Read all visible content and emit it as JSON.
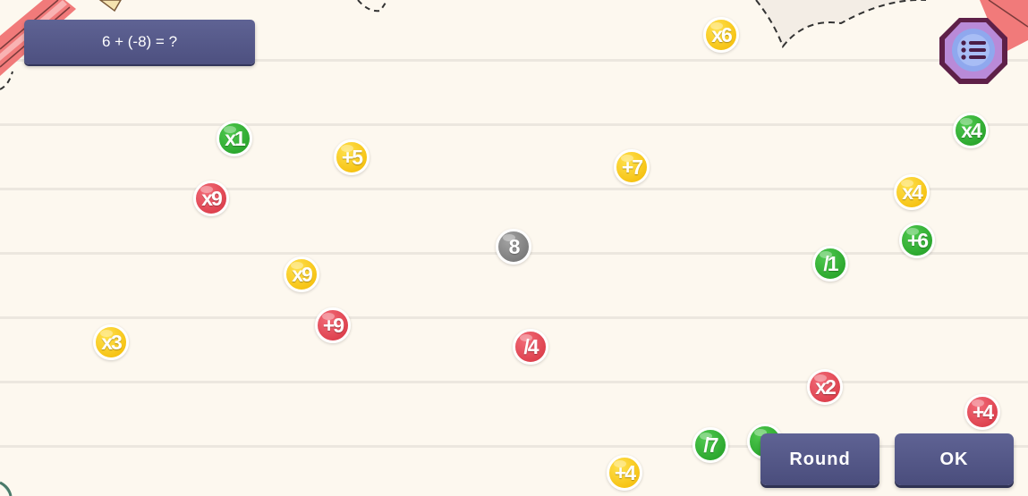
{
  "question": {
    "text": "6 + (-8) = ?"
  },
  "buttons": {
    "round": "Round",
    "ok": "OK"
  },
  "menu": {
    "icon": "list-icon"
  },
  "balls": [
    {
      "label": "x6",
      "color": "yellow"
    },
    {
      "label": "x1",
      "color": "green"
    },
    {
      "label": "+5",
      "color": "yellow"
    },
    {
      "label": "+7",
      "color": "yellow"
    },
    {
      "label": "x4",
      "color": "green"
    },
    {
      "label": "x9",
      "color": "red"
    },
    {
      "label": "x4",
      "color": "yellow"
    },
    {
      "label": "8",
      "color": "gray"
    },
    {
      "label": "+6",
      "color": "green"
    },
    {
      "label": "x9",
      "color": "yellow"
    },
    {
      "label": "/1",
      "color": "green"
    },
    {
      "label": "+9",
      "color": "red"
    },
    {
      "label": "x3",
      "color": "yellow"
    },
    {
      "label": "/4",
      "color": "red"
    },
    {
      "label": "x2",
      "color": "red"
    },
    {
      "label": "+4",
      "color": "red"
    },
    {
      "label": "/7",
      "color": "green"
    },
    {
      "label": "+",
      "color": "green"
    },
    {
      "label": "+4",
      "color": "yellow"
    }
  ],
  "colors": {
    "yellow": "#f3b800",
    "red": "#d6323f",
    "green": "#1f9b22",
    "gray": "#6d6d6d",
    "button": "#4d5080",
    "background": "#fdf8ef"
  }
}
